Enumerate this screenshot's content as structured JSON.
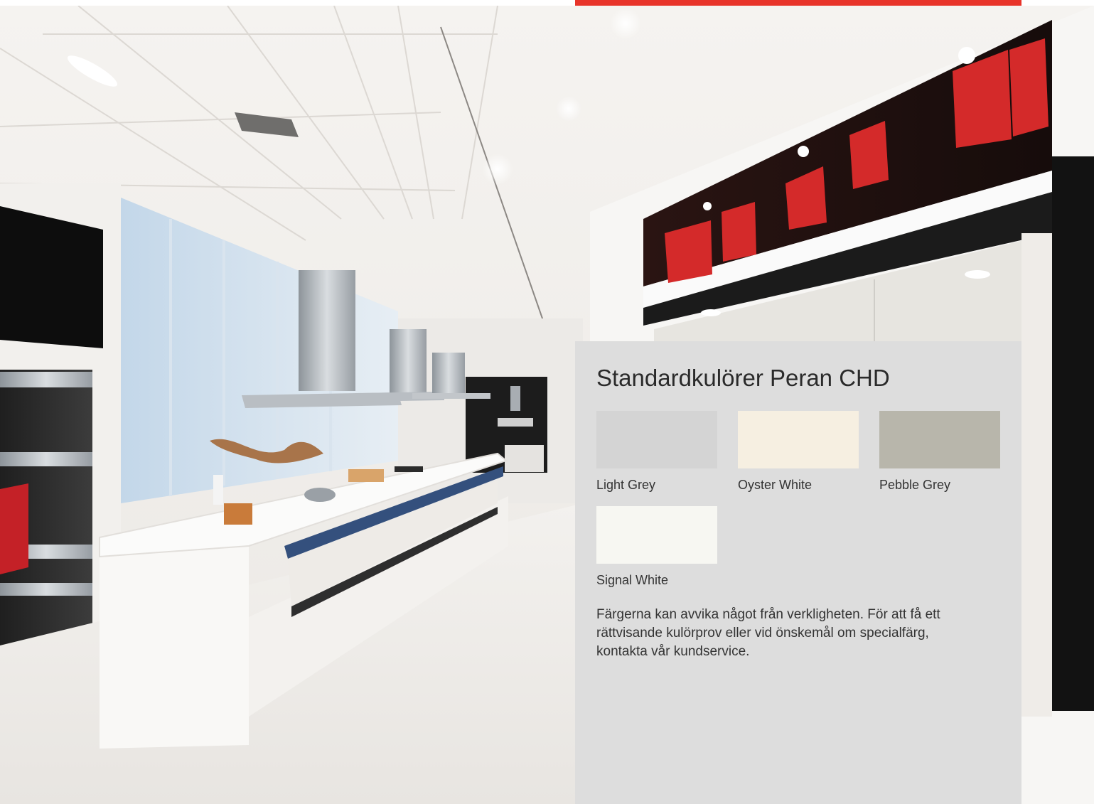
{
  "brochure": {
    "accent_color": "#e8342a",
    "panel_color": "#dddddd"
  },
  "panel": {
    "title": "Standardkulörer Peran CHD",
    "swatches": [
      {
        "name": "Light Grey",
        "color": "#d4d4d4"
      },
      {
        "name": "Oyster White",
        "color": "#f6efe1"
      },
      {
        "name": "Pebble Grey",
        "color": "#b8b6ab"
      },
      {
        "name": "Signal White",
        "color": "#f7f7f2"
      }
    ],
    "note": "Färgerna kan avvika något från verkligheten. För att få ett rättvisande kulörprov eller vid önskemål om specialfärg, kontakta vår kundservice."
  }
}
